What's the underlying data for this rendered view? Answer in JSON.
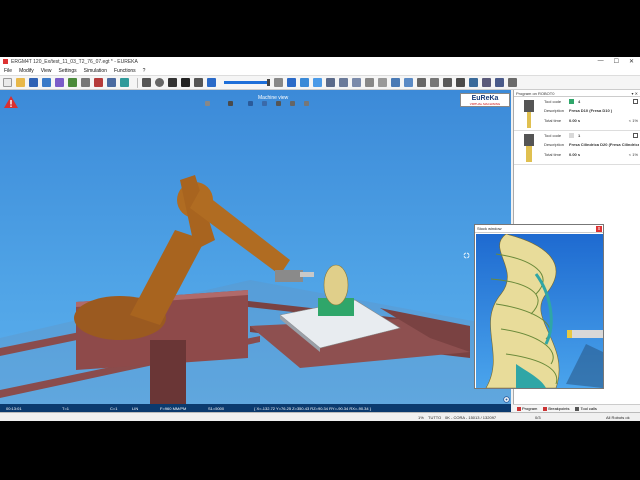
{
  "window": {
    "title": "ERGM4T 120_Ex/test_11_03_T2_76_07.egt * - EUREKA",
    "minimize": "—",
    "maximize": "☐",
    "close": "✕"
  },
  "menu": [
    "File",
    "Modify",
    "View",
    "Settings",
    "Simulation",
    "Functions",
    "?"
  ],
  "viewport": {
    "title": "Machine view",
    "brand": "EuReKa",
    "brand_sub": "VIRTUAL MACHINING"
  },
  "program_panel": {
    "title": "Program on ROBOT0",
    "pin": "▾ ✕",
    "tools": [
      {
        "code_label": "Tool code",
        "code": "4",
        "desc_label": "Description",
        "desc": "Fresa D10 (Fresa D10 )",
        "time_label": "Total time",
        "time": "0.00 s",
        "pct": "< 1%"
      },
      {
        "code_label": "Tool code",
        "code": "1",
        "desc_label": "Description",
        "desc": "Fresa Cilindrica D20 (Fresa Cilindrica",
        "time_label": "Total time",
        "time": "0.00 s",
        "pct": "< 1%"
      }
    ]
  },
  "stock_window": {
    "title": "Stock window",
    "close": "x"
  },
  "status": {
    "time": "00:13:01",
    "tool": "T=1",
    "comp": "C=1",
    "mode": "LIN",
    "feed": "F=960 MM/PM",
    "speed": "S1=5000",
    "coords": "{ X=-132.72 Y=76.25 Z=350.43 RZ=90.34 RY=-90.34 RX=-90.34 }"
  },
  "bottom": {
    "percent": "1%",
    "mode": "TUTTO",
    "count": "0K - CORA - 15013 / 132097",
    "pos": "0/3",
    "robots": "All Robots ok"
  },
  "panel_tabs": [
    "Program",
    "Breakpoints",
    "Tool calls"
  ],
  "colors": {
    "sky_top": "#3c8ad8",
    "robot": "#a25a1e",
    "floor": "#8a4c4c",
    "brand_blue": "#1a3d7a"
  }
}
